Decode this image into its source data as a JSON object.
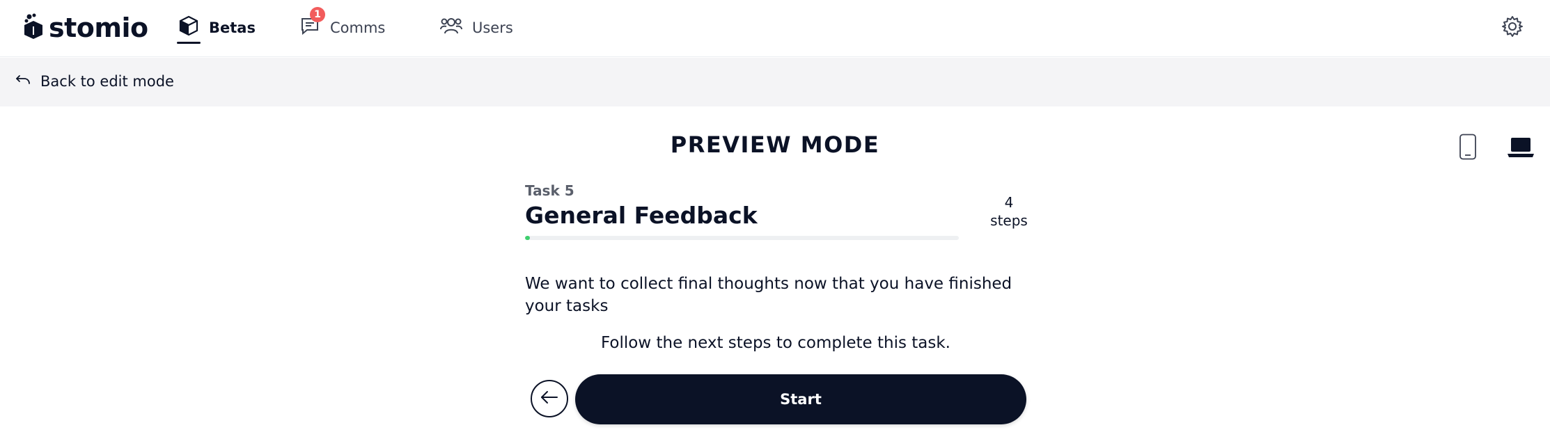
{
  "app": {
    "name": "stomio"
  },
  "nav": {
    "items": [
      {
        "label": "Betas",
        "icon": "cube-icon",
        "active": true
      },
      {
        "label": "Comms",
        "icon": "chat-icon",
        "badge": "1"
      },
      {
        "label": "Users",
        "icon": "users-icon"
      }
    ]
  },
  "toolbar": {
    "back_label": "Back to edit mode"
  },
  "preview": {
    "title": "PREVIEW MODE"
  },
  "task": {
    "label": "Task 5",
    "title": "General Feedback",
    "steps_count": "4",
    "steps_label": "steps",
    "progress_fraction": 0.01,
    "description": "We want to collect final thoughts now that you have finished your tasks",
    "instruction": "Follow the next steps to complete this task.",
    "start_label": "Start"
  },
  "colors": {
    "primary": "#0b1226",
    "badge": "#f25c5c",
    "progress": "#3ecf6e",
    "subbar": "#f4f4f6"
  }
}
